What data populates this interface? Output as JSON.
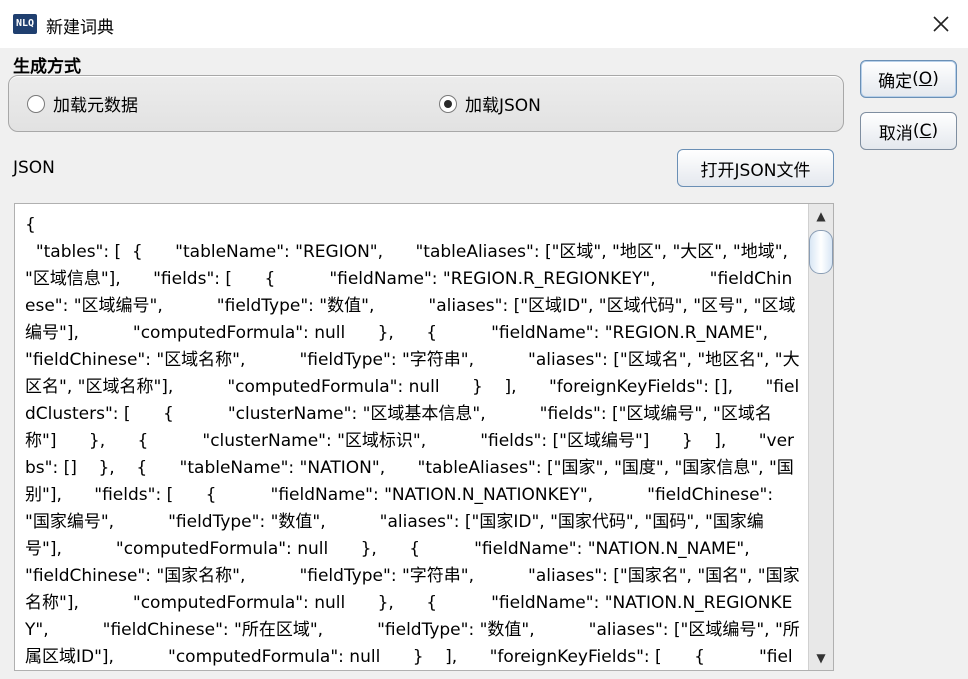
{
  "window": {
    "title": "新建词典",
    "app_icon": "NLQ"
  },
  "section": {
    "title": "生成方式"
  },
  "radios": [
    {
      "label": "加载元数据",
      "checked": false
    },
    {
      "label": "加载JSON",
      "checked": true
    }
  ],
  "buttons": {
    "ok": "确定",
    "ok_mnemonic": "O",
    "cancel": "取消",
    "cancel_mnemonic": "C",
    "open_json": "打开JSON文件"
  },
  "json_label": "JSON",
  "editor": {
    "text": "{\n  \"tables\": [  {      \"tableName\": \"REGION\",      \"tableAliases\": [\"区域\", \"地区\", \"大区\", \"地域\", \"区域信息\"],      \"fields\": [      {          \"fieldName\": \"REGION.R_REGIONKEY\",          \"fieldChinese\": \"区域编号\",          \"fieldType\": \"数值\",          \"aliases\": [\"区域ID\", \"区域代码\", \"区号\", \"区域编号\"],          \"computedFormula\": null      },      {          \"fieldName\": \"REGION.R_NAME\",          \"fieldChinese\": \"区域名称\",          \"fieldType\": \"字符串\",          \"aliases\": [\"区域名\", \"地区名\", \"大区名\", \"区域名称\"],          \"computedFormula\": null      }    ],      \"foreignKeyFields\": [],      \"fieldClusters\": [      {          \"clusterName\": \"区域基本信息\",          \"fields\": [\"区域编号\", \"区域名称\"]      },      {          \"clusterName\": \"区域标识\",          \"fields\": [\"区域编号\"]      }    ],      \"verbs\": []    },    {      \"tableName\": \"NATION\",      \"tableAliases\": [\"国家\", \"国度\", \"国家信息\", \"国别\"],      \"fields\": [      {          \"fieldName\": \"NATION.N_NATIONKEY\",          \"fieldChinese\": \"国家编号\",          \"fieldType\": \"数值\",          \"aliases\": [\"国家ID\", \"国家代码\", \"国码\", \"国家编号\"],          \"computedFormula\": null      },      {          \"fieldName\": \"NATION.N_NAME\",          \"fieldChinese\": \"国家名称\",          \"fieldType\": \"字符串\",          \"aliases\": [\"国家名\", \"国名\", \"国家名称\"],          \"computedFormula\": null      },      {          \"fieldName\": \"NATION.N_REGIONKEY\",          \"fieldChinese\": \"所在区域\",          \"fieldType\": \"数值\",          \"aliases\": [\"区域编号\", \"所属区域ID\"],          \"computedFormula\": null      }    ],      \"foreignKeyFields\": [      {          \"fieldName\": \"NATION.N_REGIONKEY.R_NAME\",          \"fieldChinese\": \"所在区域.区域名称\","
  },
  "icons": {
    "close": "close-icon",
    "scroll_up": "arrow-up-icon",
    "scroll_down": "arrow-down-icon"
  }
}
